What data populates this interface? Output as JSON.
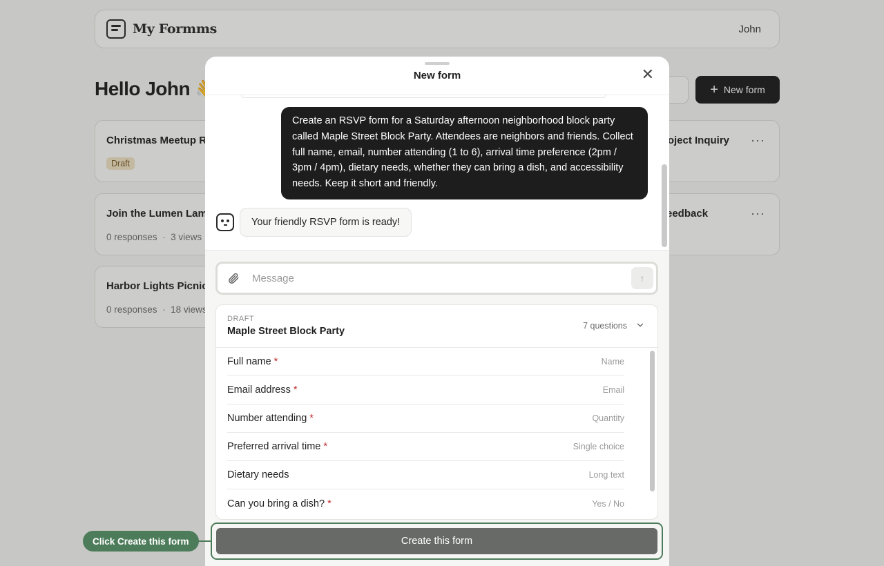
{
  "app": {
    "brand": "My Formms",
    "user": "John"
  },
  "dashboard": {
    "greeting": "Hello John",
    "wave": "👋",
    "new_form_label": "New form",
    "cards": [
      {
        "title": "Christmas Meetup R",
        "badge": "Draft"
      },
      {
        "title": "roject Inquiry"
      },
      {
        "title": "Join the Lumen Lam",
        "responses": "0 responses",
        "views": "3 views"
      },
      {
        "title": "eedback"
      },
      {
        "title": "Harbor Lights Picnic",
        "responses": "0 responses",
        "views": "18 views"
      }
    ],
    "more_glyph": "···",
    "meta_sep": "·"
  },
  "modal": {
    "title": "New form",
    "close_glyph": "✕",
    "user_message": "Create an RSVP form for a Saturday afternoon neighborhood block party called Maple Street Block Party. Attendees are neighbors and friends. Collect full name, email, number attending (1 to 6), arrival time preference (2pm / 3pm / 4pm), dietary needs, whether they can bring a dish, and accessibility needs. Keep it short and friendly.",
    "bot_message": "Your friendly RSVP form is ready!",
    "compose_placeholder": "Message",
    "send_glyph": "↑",
    "draft": {
      "label": "DRAFT",
      "name": "Maple Street Block Party",
      "count": "7 questions",
      "questions": [
        {
          "label": "Full name",
          "required": "*",
          "type": "Name"
        },
        {
          "label": "Email address",
          "required": "*",
          "type": "Email"
        },
        {
          "label": "Number attending",
          "required": "*",
          "type": "Quantity"
        },
        {
          "label": "Preferred arrival time",
          "required": "*",
          "type": "Single choice"
        },
        {
          "label": "Dietary needs",
          "required": "",
          "type": "Long text"
        },
        {
          "label": "Can you bring a dish?",
          "required": "*",
          "type": "Yes / No"
        }
      ]
    },
    "create_label": "Create this form"
  },
  "hint": "Click Create this form",
  "colors": {
    "accent": "#4d7c5a",
    "dark": "#1d1d1d",
    "required": "#c03030"
  }
}
